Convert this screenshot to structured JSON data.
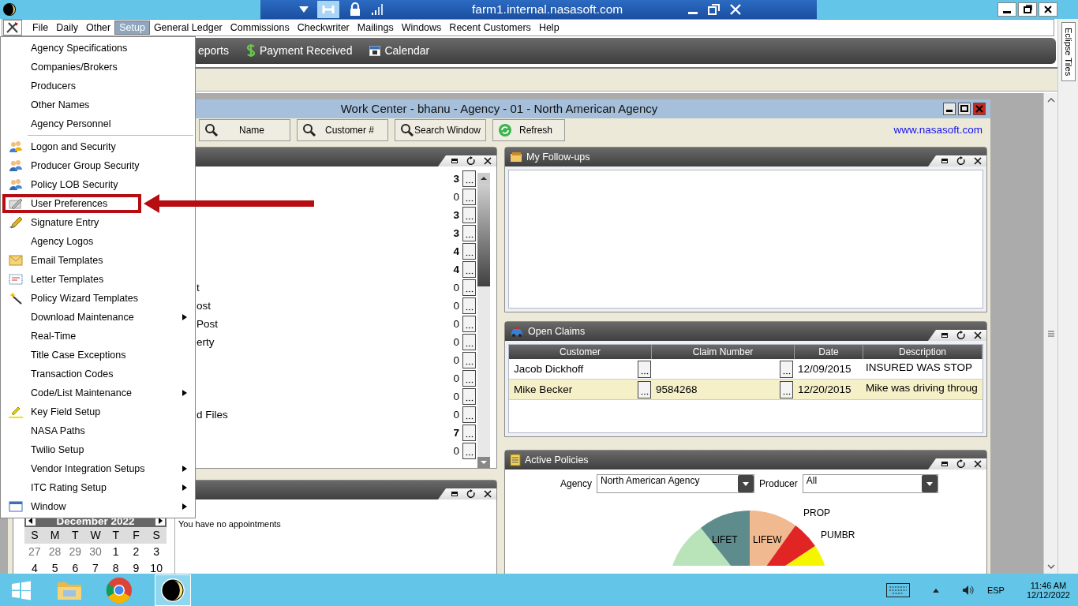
{
  "remote_bar": {
    "host": "farm1.internal.nasasoft.com"
  },
  "menu_bar": {
    "items": [
      {
        "label": "File",
        "selected": false
      },
      {
        "label": "Daily",
        "selected": false
      },
      {
        "label": "Other",
        "selected": false
      },
      {
        "label": "Setup",
        "selected": true
      },
      {
        "label": "General Ledger",
        "selected": false
      },
      {
        "label": "Commissions",
        "selected": false
      },
      {
        "label": "Checkwriter",
        "selected": false
      },
      {
        "label": "Mailings",
        "selected": false
      },
      {
        "label": "Windows",
        "selected": false
      },
      {
        "label": "Recent Customers",
        "selected": false
      },
      {
        "label": "Help",
        "selected": false
      }
    ]
  },
  "toolbar": {
    "items": [
      {
        "label": "eports",
        "kind": "plain"
      },
      {
        "label": "Payment Received",
        "kind": "dollar"
      },
      {
        "label": "Calendar",
        "kind": "calendar"
      }
    ]
  },
  "setup_menu": {
    "items": [
      {
        "label": "Agency Specifications",
        "submenu": false,
        "separator_before": false,
        "callout": false
      },
      {
        "label": "Companies/Brokers",
        "submenu": false,
        "separator_before": false,
        "callout": false
      },
      {
        "label": "Producers",
        "submenu": false,
        "separator_before": false,
        "callout": false
      },
      {
        "label": "Other Names",
        "submenu": false,
        "separator_before": false,
        "callout": false
      },
      {
        "label": "Agency Personnel",
        "submenu": false,
        "separator_before": false,
        "callout": false
      },
      {
        "label": "Logon and Security",
        "submenu": false,
        "separator_before": true,
        "callout": false
      },
      {
        "label": "Producer Group Security",
        "submenu": false,
        "separator_before": false,
        "callout": false
      },
      {
        "label": "Policy LOB Security",
        "submenu": false,
        "separator_before": false,
        "callout": false
      },
      {
        "label": "User Preferences",
        "submenu": false,
        "separator_before": false,
        "callout": true
      },
      {
        "label": "Signature Entry",
        "submenu": false,
        "separator_before": false,
        "callout": false
      },
      {
        "label": "Agency Logos",
        "submenu": false,
        "separator_before": false,
        "callout": false
      },
      {
        "label": "Email Templates",
        "submenu": false,
        "separator_before": false,
        "callout": false
      },
      {
        "label": "Letter Templates",
        "submenu": false,
        "separator_before": false,
        "callout": false
      },
      {
        "label": "Policy Wizard Templates",
        "submenu": false,
        "separator_before": false,
        "callout": false
      },
      {
        "label": "Download Maintenance",
        "submenu": true,
        "separator_before": false,
        "callout": false
      },
      {
        "label": "Real-Time",
        "submenu": false,
        "separator_before": false,
        "callout": false
      },
      {
        "label": "Title Case Exceptions",
        "submenu": false,
        "separator_before": false,
        "callout": false
      },
      {
        "label": "Transaction Codes",
        "submenu": false,
        "separator_before": false,
        "callout": false
      },
      {
        "label": "Code/List Maintenance",
        "submenu": true,
        "separator_before": false,
        "callout": false
      },
      {
        "label": "Key Field Setup",
        "submenu": false,
        "separator_before": false,
        "callout": false
      },
      {
        "label": "NASA Paths",
        "submenu": false,
        "separator_before": false,
        "callout": false
      },
      {
        "label": "Twilio Setup",
        "submenu": false,
        "separator_before": false,
        "callout": false
      },
      {
        "label": "Vendor Integration Setups",
        "submenu": true,
        "separator_before": false,
        "callout": false
      },
      {
        "label": "ITC Rating Setup",
        "submenu": true,
        "separator_before": false,
        "callout": false
      },
      {
        "label": "Window",
        "submenu": true,
        "separator_before": false,
        "callout": false
      }
    ]
  },
  "work_center": {
    "title": "Work Center - bhanu - Agency - 01 - North American Agency",
    "search_buttons": [
      {
        "label": "Name"
      },
      {
        "label": "Customer #"
      },
      {
        "label": "Search Window"
      }
    ],
    "refresh": "Refresh",
    "link": "www.nasasoft.com",
    "list_panel": {
      "rows": [
        {
          "count": "3",
          "bold": true
        },
        {
          "count": "0",
          "bold": false
        },
        {
          "count": "3",
          "bold": true
        },
        {
          "count": "3",
          "bold": true
        },
        {
          "count": "4",
          "bold": true
        },
        {
          "count": "4",
          "bold": true
        },
        {
          "label": "t",
          "count": "0",
          "bold": false
        },
        {
          "label": "ost",
          "count": "0",
          "bold": false
        },
        {
          "label": "Post",
          "count": "0",
          "bold": false
        },
        {
          "label": "erty",
          "count": "0",
          "bold": false
        },
        {
          "count": "0",
          "bold": false
        },
        {
          "count": "0",
          "bold": false
        },
        {
          "count": "0",
          "bold": false
        },
        {
          "label": "d Files",
          "count": "0",
          "bold": false
        },
        {
          "count": "7",
          "bold": true
        },
        {
          "count": "0",
          "bold": false
        }
      ]
    },
    "calendar_panel": {
      "month": "December 2022",
      "weekdays": [
        "S",
        "M",
        "T",
        "W",
        "T",
        "F",
        "S"
      ],
      "weeks": [
        [
          {
            "day": "27",
            "muted": true
          },
          {
            "day": "28",
            "muted": true
          },
          {
            "day": "29",
            "muted": true
          },
          {
            "day": "30",
            "muted": true
          },
          {
            "day": "1",
            "muted": false
          },
          {
            "day": "2",
            "muted": false
          },
          {
            "day": "3",
            "muted": false
          }
        ],
        [
          {
            "day": "4",
            "muted": false
          },
          {
            "day": "5",
            "muted": false
          },
          {
            "day": "6",
            "muted": false
          },
          {
            "day": "7",
            "muted": false
          },
          {
            "day": "8",
            "muted": false
          },
          {
            "day": "9",
            "muted": false
          },
          {
            "day": "10",
            "muted": false
          }
        ]
      ],
      "appointments": "You have no appointments"
    },
    "follow_ups": {
      "title": "My Follow-ups"
    },
    "open_claims": {
      "title": "Open Claims",
      "columns": [
        "Customer",
        "Claim Number",
        "Date",
        "Description"
      ],
      "rows": [
        {
          "customer": "Jacob Dickhoff",
          "date": "12/09/2015",
          "description": "INSURED WAS STOP",
          "selected": false
        },
        {
          "customer": "Mike Becker",
          "claim_number": "9584268",
          "date": "12/20/2015",
          "description": "Mike was driving throug",
          "selected": true
        }
      ]
    },
    "active_policies": {
      "title": "Active Policies",
      "agency_label": "Agency",
      "agency_value": "North American Agency",
      "producer_label": "Producer",
      "producer_value": "All",
      "pie_labels": [
        "LIFET",
        "LIFEW",
        "PROP",
        "PUMBR"
      ]
    }
  },
  "side_tab": {
    "label": "Eclipse Tiles"
  },
  "taskbar": {
    "language": "ESP",
    "time": "11:46 AM",
    "date": "12/12/2022"
  }
}
